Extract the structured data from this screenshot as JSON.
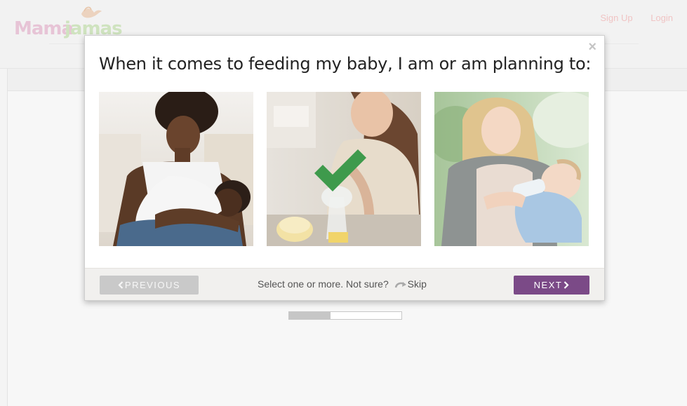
{
  "header": {
    "logo_text_1": "Mama",
    "logo_text_2": "jamas",
    "signup_label": "Sign Up",
    "login_label": "Login"
  },
  "modal": {
    "question": "When it comes to feeding my baby, I am or am planning to:",
    "close_symbol": "×",
    "options": [
      {
        "id": "breastfeeding",
        "selected": false
      },
      {
        "id": "pumping",
        "selected": true
      },
      {
        "id": "bottle-feeding",
        "selected": false
      }
    ],
    "footer": {
      "prev_label": "PREVIOUS",
      "next_label": "NEXT",
      "hint_text": "Select one or more. Not sure?",
      "skip_label": "Skip"
    }
  },
  "progress": {
    "fraction": 0.37
  },
  "colors": {
    "accent": "#7b4a87",
    "check": "#3e9a4c",
    "disabled_button": "#c9c9c9"
  }
}
